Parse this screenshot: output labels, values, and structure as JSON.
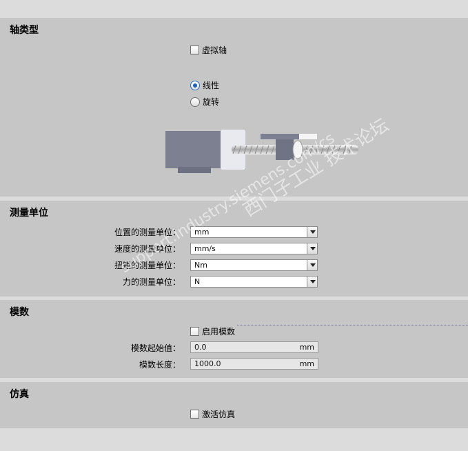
{
  "axis_type": {
    "title": "轴类型",
    "virtual_axis": {
      "label": "虚拟轴",
      "checked": false
    },
    "options": [
      {
        "label": "线性",
        "selected": true
      },
      {
        "label": "旋转",
        "selected": false
      }
    ]
  },
  "measurement_units": {
    "title": "测量单位",
    "fields": [
      {
        "label": "位置的测量单位：",
        "value": "mm"
      },
      {
        "label": "速度的测量单位：",
        "value": "mm/s"
      },
      {
        "label": "扭矩的测量单位：",
        "value": "Nm"
      },
      {
        "label": "力的测量单位：",
        "value": "N"
      }
    ]
  },
  "modulo": {
    "title": "模数",
    "enable": {
      "label": "启用模数",
      "checked": false
    },
    "start": {
      "label": "模数起始值：",
      "value": "0.0",
      "unit": "mm"
    },
    "length": {
      "label": "模数长度：",
      "value": "1000.0",
      "unit": "mm"
    }
  },
  "simulation": {
    "title": "仿真",
    "activate": {
      "label": "激活仿真",
      "checked": false
    }
  },
  "watermark": {
    "line1": "西门子工业 技术论坛",
    "line2": "support.industry.siemens.com/cs"
  }
}
